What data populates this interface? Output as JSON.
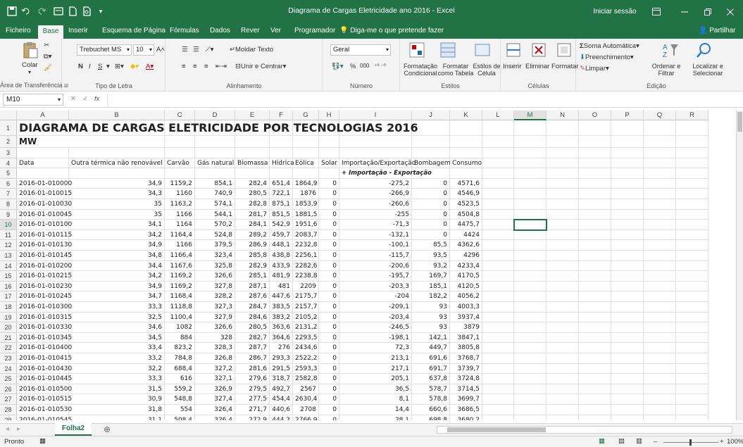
{
  "window": {
    "title": "Diagrama de Cargas Eletricidade ano 2016 - Excel",
    "signin": "Iniciar sessão",
    "share": "Partilhar"
  },
  "tabs": [
    "Ficheiro",
    "Base",
    "Inserir",
    "Esquema de Página",
    "Fórmulas",
    "Dados",
    "Rever",
    "Ver",
    "Programador"
  ],
  "tell_me": "Diga-me o que pretende fazer",
  "ribbon": {
    "clipboard": {
      "paste": "Colar",
      "label": "Área de Transferência"
    },
    "font": {
      "name": "Trebuchet MS",
      "size": "10",
      "label": "Tipo de Letra",
      "bold": "N",
      "italic": "I",
      "underline": "S"
    },
    "alignment": {
      "wrap": "Moldar Texto",
      "merge": "Unir e Centrar",
      "label": "Alinhamento"
    },
    "number": {
      "format": "Geral",
      "label": "Número",
      "percent": "%",
      "thousands": "000"
    },
    "styles": {
      "cond_fmt": "Formatação Condicional",
      "table_fmt": "Formatar como Tabela",
      "cell_styles": "Estilos de Célula",
      "label": "Estilos"
    },
    "cells": {
      "insert": "Inserir",
      "delete": "Eliminar",
      "format": "Formatar",
      "label": "Células"
    },
    "editing": {
      "autosum": "Soma Automática",
      "fill": "Preenchimento",
      "clear": "Limpar",
      "sort": "Ordenar e Filtrar",
      "find": "Localizar e Selecionar",
      "label": "Edição"
    }
  },
  "formula_bar": {
    "name_box": "M10",
    "fx": "fx",
    "value": ""
  },
  "columns": [
    "A",
    "B",
    "C",
    "D",
    "E",
    "F",
    "G",
    "H",
    "I",
    "J",
    "K",
    "L",
    "M",
    "N",
    "O",
    "P",
    "Q",
    "R"
  ],
  "selected_cell": {
    "col": "M",
    "row": 10
  },
  "sheet": {
    "title": "DIAGRAMA DE CARGAS ELETRICIDADE POR TECNOLOGIAS 2016",
    "unit": "MW",
    "headers": [
      "Data",
      "Outra térmica não renovável",
      "Carvão",
      "Gás natural",
      "Biomassa",
      "Hídrica",
      "Eólica",
      "Solar",
      "Importação/Exportação",
      "Bombagem",
      "Consumo"
    ],
    "note": "+ Importação - Exportação",
    "rows": [
      [
        "2016-01-010000",
        "34,9",
        "1159,2",
        "854,1",
        "282,4",
        "651,4",
        "1864,9",
        "0",
        "-275,2",
        "0",
        "4571,6"
      ],
      [
        "2016-01-010015",
        "34,3",
        "1160",
        "740,9",
        "280,5",
        "722,1",
        "1876",
        "0",
        "-266,9",
        "0",
        "4546,9"
      ],
      [
        "2016-01-010030",
        "35",
        "1163,2",
        "574,1",
        "282,8",
        "875,1",
        "1853,9",
        "0",
        "-260,6",
        "0",
        "4523,5"
      ],
      [
        "2016-01-010045",
        "35",
        "1166",
        "544,1",
        "281,7",
        "851,5",
        "1881,5",
        "0",
        "-255",
        "0",
        "4504,8"
      ],
      [
        "2016-01-010100",
        "34,1",
        "1164",
        "570,2",
        "284,1",
        "542,9",
        "1951,6",
        "0",
        "-71,3",
        "0",
        "4475,7"
      ],
      [
        "2016-01-010115",
        "34,2",
        "1164,4",
        "524,8",
        "289,2",
        "459,7",
        "2083,7",
        "0",
        "-132,1",
        "0",
        "4424"
      ],
      [
        "2016-01-010130",
        "34,9",
        "1166",
        "379,5",
        "286,9",
        "448,1",
        "2232,8",
        "0",
        "-100,1",
        "85,5",
        "4362,6"
      ],
      [
        "2016-01-010145",
        "34,8",
        "1166,4",
        "323,4",
        "285,8",
        "438,8",
        "2256,1",
        "0",
        "-115,7",
        "93,5",
        "4296"
      ],
      [
        "2016-01-010200",
        "34,4",
        "1167,6",
        "325,8",
        "282,9",
        "433,9",
        "2282,6",
        "0",
        "-200,6",
        "93,2",
        "4233,4"
      ],
      [
        "2016-01-010215",
        "34,2",
        "1169,2",
        "326,6",
        "285,1",
        "481,9",
        "2238,8",
        "0",
        "-195,7",
        "169,7",
        "4170,5"
      ],
      [
        "2016-01-010230",
        "34,9",
        "1169,2",
        "327,8",
        "287,1",
        "481",
        "2209",
        "0",
        "-203,3",
        "185,1",
        "4120,5"
      ],
      [
        "2016-01-010245",
        "34,7",
        "1168,4",
        "328,2",
        "287,6",
        "447,6",
        "2175,7",
        "0",
        "-204",
        "182,2",
        "4056,2"
      ],
      [
        "2016-01-010300",
        "33,3",
        "1118,8",
        "327,3",
        "284,7",
        "383,5",
        "2157,7",
        "0",
        "-209,1",
        "93",
        "4003,3"
      ],
      [
        "2016-01-010315",
        "32,5",
        "1100,4",
        "327,9",
        "284,6",
        "383,2",
        "2105,2",
        "0",
        "-203,4",
        "93",
        "3937,4"
      ],
      [
        "2016-01-010330",
        "34,6",
        "1082",
        "326,6",
        "280,5",
        "363,6",
        "2131,2",
        "0",
        "-246,5",
        "93",
        "3879"
      ],
      [
        "2016-01-010345",
        "34,5",
        "884",
        "328",
        "282,7",
        "364,6",
        "2293,5",
        "0",
        "-198,1",
        "142,1",
        "3847,1"
      ],
      [
        "2016-01-010400",
        "33,4",
        "823,2",
        "328,3",
        "287,7",
        "276",
        "2434,6",
        "0",
        "72,3",
        "449,7",
        "3805,8"
      ],
      [
        "2016-01-010415",
        "33,2",
        "784,8",
        "326,8",
        "286,7",
        "293,3",
        "2522,2",
        "0",
        "213,1",
        "691,6",
        "3768,7"
      ],
      [
        "2016-01-010430",
        "32,2",
        "688,4",
        "327,2",
        "281,6",
        "291,5",
        "2593,3",
        "0",
        "217,1",
        "691,7",
        "3739,7"
      ],
      [
        "2016-01-010445",
        "33,3",
        "616",
        "327,1",
        "279,6",
        "318,7",
        "2582,8",
        "0",
        "205,1",
        "637,8",
        "3724,8"
      ],
      [
        "2016-01-010500",
        "31,5",
        "559,2",
        "326,9",
        "279,5",
        "492,7",
        "2567",
        "0",
        "36,5",
        "578,7",
        "3714,5"
      ],
      [
        "2016-01-010515",
        "30,9",
        "548,8",
        "327,4",
        "277,5",
        "454,4",
        "2630,4",
        "0",
        "8,1",
        "578,8",
        "3699,7"
      ],
      [
        "2016-01-010530",
        "31,8",
        "554",
        "326,4",
        "271,7",
        "440,6",
        "2708",
        "0",
        "14,4",
        "660,6",
        "3686,5"
      ],
      [
        "2016-01-010545",
        "31,1",
        "508,4",
        "326,4",
        "272,9",
        "444,2",
        "2766,9",
        "0",
        "28,1",
        "698,8",
        "3680,2"
      ]
    ]
  },
  "sheet_tab": "Folha2",
  "status": {
    "ready": "Pronto",
    "zoom": "100%"
  }
}
